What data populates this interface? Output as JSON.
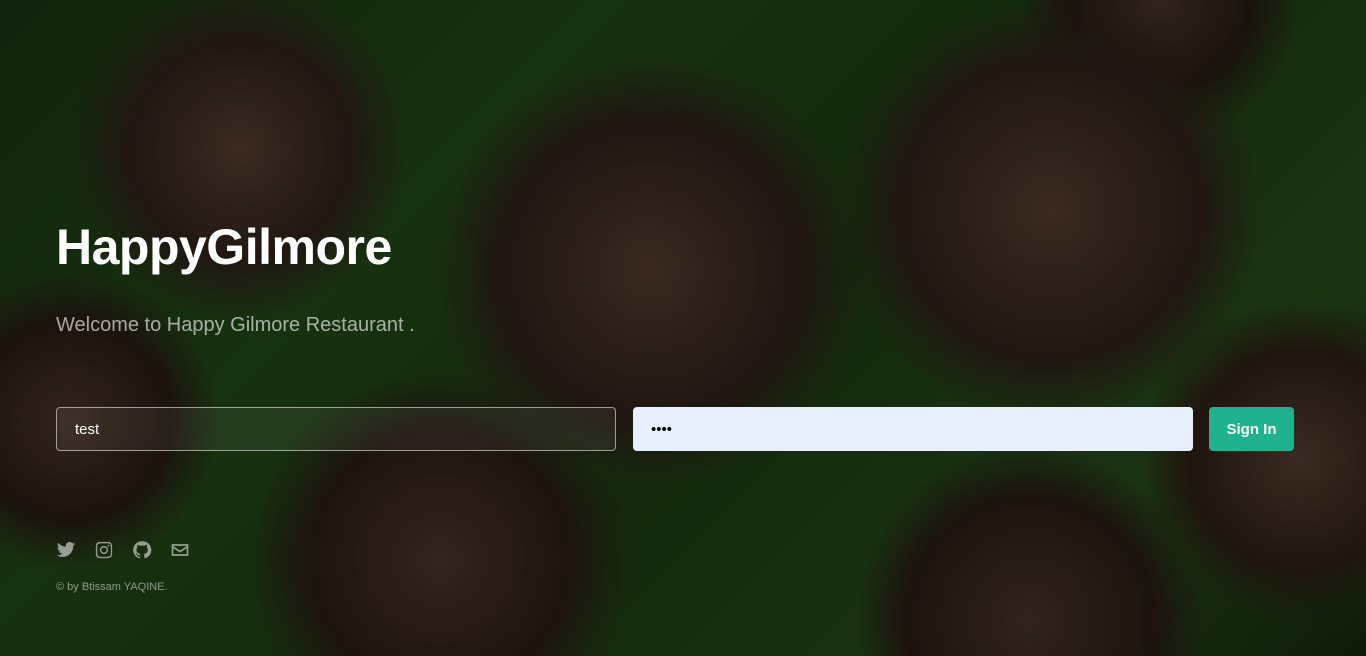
{
  "hero": {
    "title": "HappyGilmore",
    "subtitle": "Welcome to Happy Gilmore Restaurant ."
  },
  "login_form": {
    "username_value": "test",
    "password_value": "••••",
    "sign_in_label": "Sign In"
  },
  "social": {
    "icons": [
      "twitter-icon",
      "instagram-icon",
      "github-icon",
      "envelope-icon"
    ]
  },
  "footer": {
    "copyright": "© by Btissam YAQINE."
  },
  "colors": {
    "accent": "#1fb28e",
    "password_field_bg": "#e8f0fe"
  }
}
